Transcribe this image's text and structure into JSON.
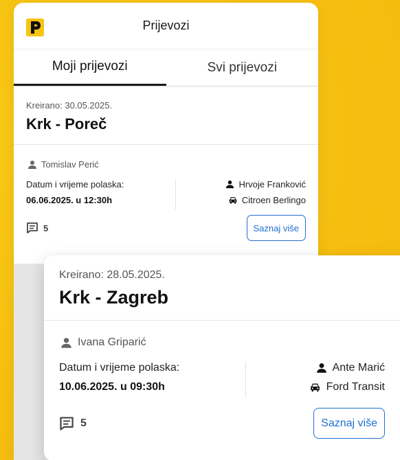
{
  "header": {
    "title": "Prijevozi",
    "logo_icon": "parking-p-logo"
  },
  "tabs": [
    {
      "label": "Moji prijevozi",
      "active": true
    },
    {
      "label": "Svi prijevozi",
      "active": false
    }
  ],
  "rides": [
    {
      "created": "Kreirano: 30.05.2025.",
      "route": "Krk - Poreč",
      "passenger": "Tomislav Perić",
      "departure_label": "Datum i vrijeme polaska:",
      "departure_value": "06.06.2025. u 12:30h",
      "driver": "Hrvoje Franković",
      "vehicle": "Citroen Berlingo",
      "comments_count": "5",
      "more_button": "Saznaj više"
    },
    {
      "created": "Kreirano: 28.05.2025.",
      "route": "Krk - Zagreb",
      "passenger": "Ivana Griparić",
      "departure_label": "Datum i vrijeme polaska:",
      "departure_value": "10.06.2025. u 09:30h",
      "driver": "Ante Marić",
      "vehicle": "Ford Transit",
      "comments_count": "5",
      "more_button": "Saznaj više"
    }
  ],
  "colors": {
    "background": "#f8c414",
    "accent": "#1f6fd1"
  }
}
